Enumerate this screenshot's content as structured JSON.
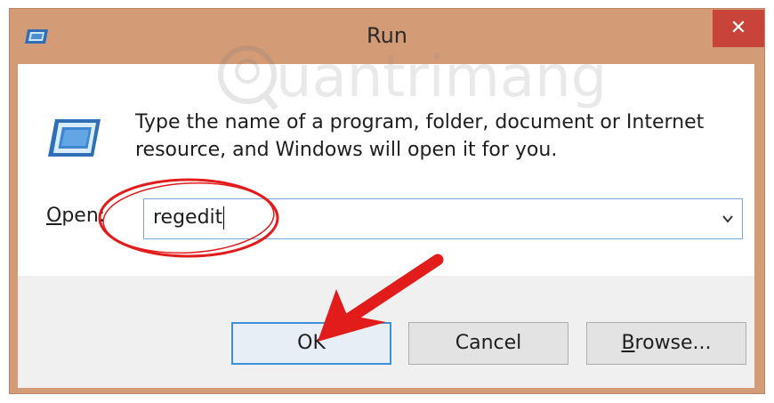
{
  "window": {
    "title": "Run",
    "close_glyph": "✕"
  },
  "dialog": {
    "description_line1": "Type the name of a program, folder, document or Internet",
    "description_line2": "resource, and Windows will open it for you.",
    "open_label_accel": "O",
    "open_label_rest": "pen:",
    "open_value": "regedit",
    "dropdown_glyph": "⌄"
  },
  "buttons": {
    "ok_label": "OK",
    "cancel_label": "Cancel",
    "browse_label_accel": "B",
    "browse_label_rest": "rowse..."
  },
  "watermark": {
    "text": "uantrimang"
  },
  "colors": {
    "frame": "#d49b77",
    "close": "#c8443a",
    "annotation_red": "#e21b1b",
    "focus_blue": "#3c8fd9"
  },
  "icons": {
    "app": "run-dialog-icon",
    "close": "close-icon",
    "dropdown": "chevron-down-icon"
  }
}
